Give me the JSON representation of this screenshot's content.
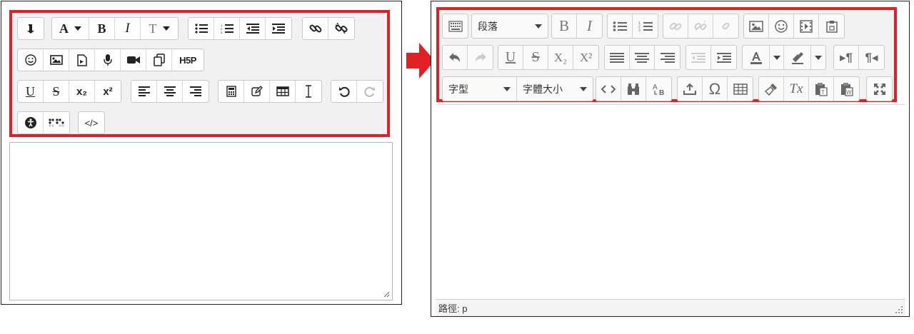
{
  "colors": {
    "highlight": "#e02025",
    "arrow": "#e02025",
    "toolbar_bg": "#f1f1f1",
    "button_border": "#c8c8c8"
  },
  "left_editor": {
    "name": "atto-editor",
    "toolbar": {
      "row1": {
        "groups": [
          [
            "collapse-icon"
          ],
          [
            "font-color-icon",
            "bold-icon",
            "italic-icon",
            "font-size-icon"
          ],
          [
            "unordered-list-icon",
            "ordered-list-icon",
            "outdent-icon",
            "indent-icon"
          ],
          [
            "link-icon",
            "unlink-icon"
          ]
        ],
        "texts": {
          "font_color": "A",
          "bold": "B",
          "italic": "I",
          "font_size": "T"
        }
      },
      "row2": {
        "groups": [
          [
            "emoji-icon",
            "image-icon",
            "media-file-icon",
            "record-audio-icon",
            "record-video-icon",
            "manage-files-icon",
            "h5p-icon"
          ]
        ],
        "texts": {
          "h5p": "H5P"
        }
      },
      "row3": {
        "groups": [
          [
            "underline-icon",
            "strikethrough-icon",
            "subscript-icon",
            "superscript-icon"
          ],
          [
            "align-left-icon",
            "align-center-icon",
            "align-right-icon"
          ],
          [
            "equation-icon",
            "edit-icon",
            "table-icon",
            "text-cursor-icon"
          ],
          [
            "undo-icon",
            "redo-icon"
          ]
        ],
        "texts": {
          "underline": "U",
          "strike": "S",
          "sub": "x₂",
          "sup": "x²"
        }
      },
      "row4": {
        "groups": [
          [
            "accessibility-icon",
            "braille-icon"
          ],
          [
            "html-icon"
          ]
        ],
        "texts": {
          "html": "</>"
        }
      }
    }
  },
  "right_editor": {
    "name": "tinymce-editor",
    "toolbar": {
      "paragraph_select": "段落",
      "font_family_select": "字型",
      "font_size_select": "字體大小",
      "texts": {
        "bold": "B",
        "italic": "I",
        "underline": "U",
        "strike": "S",
        "sub": "X₂",
        "sup": "X²",
        "clear_format": "Tx",
        "pilcrow_ltr": "▸¶",
        "pilcrow_rtl": "¶◂"
      }
    },
    "status": {
      "path_label": "路徑: p"
    }
  }
}
